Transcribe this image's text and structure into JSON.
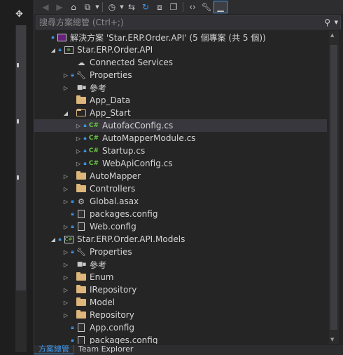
{
  "search": {
    "placeholder": "搜尋方案總管 (Ctrl+;)"
  },
  "tree": [
    {
      "label": "解決方案 'Star.ERP.Order.API' (5 個專案 (共 5 個))",
      "icon": "solution-icon",
      "arrow": "",
      "lock": true,
      "depth": 0
    },
    {
      "label": "Star.ERP.Order.API",
      "icon": "web-project-icon",
      "arrow": "expanded",
      "lock": true,
      "depth": 1,
      "bold": true
    },
    {
      "label": "Connected Services",
      "icon": "cloud-icon",
      "arrow": "",
      "lock": false,
      "depth": 2
    },
    {
      "label": "Properties",
      "icon": "wrench-icon",
      "arrow": "collapsed",
      "lock": true,
      "depth": 2
    },
    {
      "label": "參考",
      "icon": "references-icon",
      "arrow": "collapsed",
      "lock": false,
      "depth": 2
    },
    {
      "label": "App_Data",
      "icon": "folder-icon",
      "arrow": "",
      "lock": false,
      "depth": 2
    },
    {
      "label": "App_Start",
      "icon": "folder-open-icon",
      "arrow": "expanded",
      "lock": false,
      "depth": 2
    },
    {
      "label": "AutofacConfig.cs",
      "icon": "csharp-file-icon",
      "arrow": "collapsed",
      "lock": true,
      "depth": 3,
      "selected": true
    },
    {
      "label": "AutoMapperModule.cs",
      "icon": "csharp-file-icon",
      "arrow": "collapsed",
      "lock": true,
      "depth": 3
    },
    {
      "label": "Startup.cs",
      "icon": "csharp-file-icon",
      "arrow": "collapsed",
      "lock": true,
      "depth": 3
    },
    {
      "label": "WebApiConfig.cs",
      "icon": "csharp-file-icon",
      "arrow": "collapsed",
      "lock": true,
      "depth": 3
    },
    {
      "label": "AutoMapper",
      "icon": "folder-icon",
      "arrow": "collapsed",
      "lock": false,
      "depth": 2
    },
    {
      "label": "Controllers",
      "icon": "folder-icon",
      "arrow": "collapsed",
      "lock": false,
      "depth": 2
    },
    {
      "label": "Global.asax",
      "icon": "asax-file-icon",
      "arrow": "collapsed",
      "lock": true,
      "depth": 2
    },
    {
      "label": "packages.config",
      "icon": "config-file-icon",
      "arrow": "",
      "lock": true,
      "depth": 2
    },
    {
      "label": "Web.config",
      "icon": "config-file-icon",
      "arrow": "collapsed",
      "lock": true,
      "depth": 2
    },
    {
      "label": "Star.ERP.Order.API.Models",
      "icon": "csharp-project-icon",
      "arrow": "expanded",
      "lock": true,
      "depth": 1
    },
    {
      "label": "Properties",
      "icon": "wrench-icon",
      "arrow": "collapsed",
      "lock": true,
      "depth": 2
    },
    {
      "label": "參考",
      "icon": "references-icon",
      "arrow": "collapsed",
      "lock": false,
      "depth": 2
    },
    {
      "label": "Enum",
      "icon": "folder-icon",
      "arrow": "collapsed",
      "lock": false,
      "depth": 2
    },
    {
      "label": "IRepository",
      "icon": "folder-icon",
      "arrow": "collapsed",
      "lock": false,
      "depth": 2
    },
    {
      "label": "Model",
      "icon": "folder-icon",
      "arrow": "collapsed",
      "lock": false,
      "depth": 2
    },
    {
      "label": "Repository",
      "icon": "folder-icon",
      "arrow": "collapsed",
      "lock": false,
      "depth": 2
    },
    {
      "label": "App.config",
      "icon": "config-file-icon",
      "arrow": "",
      "lock": true,
      "depth": 2
    },
    {
      "label": "packages.config",
      "icon": "config-file-icon",
      "arrow": "",
      "lock": true,
      "depth": 2
    }
  ],
  "tabs": [
    {
      "label": "方案總管",
      "active": true
    },
    {
      "label": "Team Explorer",
      "active": false
    }
  ],
  "colors": {
    "accent": "#3d9cf0",
    "folder": "#dcb67a",
    "csharp": "#6cc644",
    "background": "#252526"
  }
}
